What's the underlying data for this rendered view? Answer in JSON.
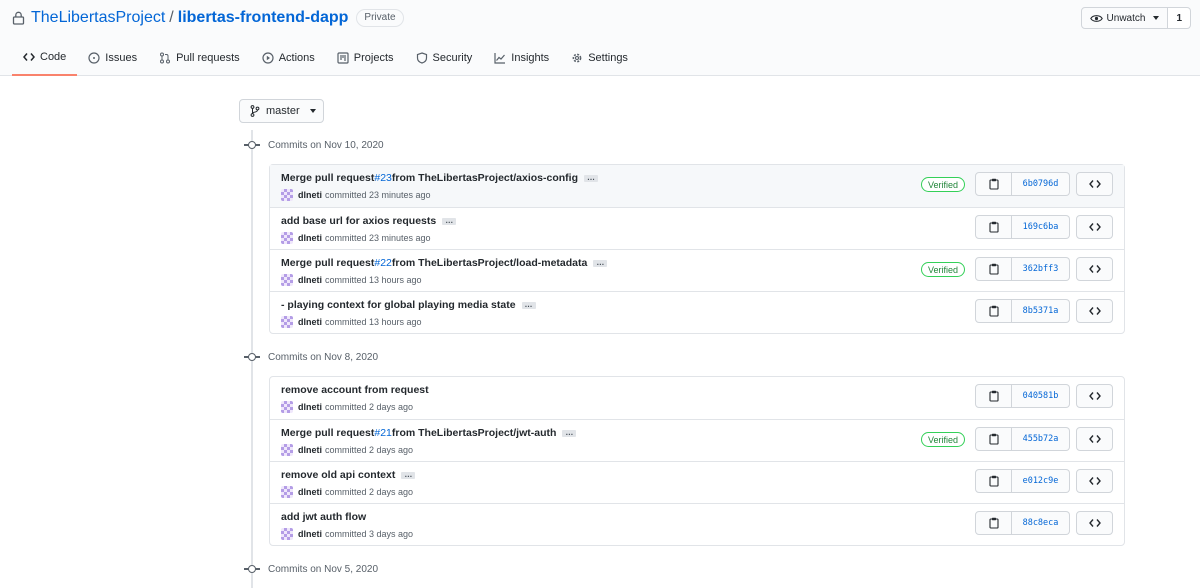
{
  "repo": {
    "owner": "TheLibertasProject",
    "separator": "/",
    "name": "libertas-frontend-dapp",
    "visibility": "Private"
  },
  "watch": {
    "label": "Unwatch",
    "count": "1"
  },
  "tabs": [
    {
      "label": "Code",
      "icon": "code-icon",
      "selected": true
    },
    {
      "label": "Issues",
      "icon": "issue-icon"
    },
    {
      "label": "Pull requests",
      "icon": "pull-request-icon"
    },
    {
      "label": "Actions",
      "icon": "play-icon"
    },
    {
      "label": "Projects",
      "icon": "project-icon"
    },
    {
      "label": "Security",
      "icon": "shield-icon"
    },
    {
      "label": "Insights",
      "icon": "graph-icon"
    },
    {
      "label": "Settings",
      "icon": "gear-icon"
    }
  ],
  "branch": {
    "name": "master"
  },
  "colors": {
    "link": "#0366d6",
    "tab_underline": "#f9826c",
    "verified": "#22863a"
  },
  "groups": [
    {
      "label": "Commits on Nov 10, 2020",
      "commits": [
        {
          "prefix": "Merge pull request ",
          "pr": "#23",
          "suffix": " from TheLibertasProject/axios-config",
          "author": "dlneti",
          "time": "committed 23 minutes ago",
          "verified": "Verified",
          "sha": "6b0796d",
          "highlight": true
        },
        {
          "prefix": "add base url for axios requests",
          "pr": "",
          "suffix": "",
          "author": "dlneti",
          "time": "committed 23 minutes ago",
          "verified": "",
          "sha": "169c6ba"
        },
        {
          "prefix": "Merge pull request ",
          "pr": "#22",
          "suffix": " from TheLibertasProject/load-metadata",
          "author": "dlneti",
          "time": "committed 13 hours ago",
          "verified": "Verified",
          "sha": "362bff3"
        },
        {
          "prefix": "- playing context for global playing media state",
          "pr": "",
          "suffix": "",
          "author": "dlneti",
          "time": "committed 13 hours ago",
          "verified": "",
          "sha": "8b5371a"
        }
      ]
    },
    {
      "label": "Commits on Nov 8, 2020",
      "commits": [
        {
          "prefix": "remove account from request",
          "pr": "",
          "suffix": "",
          "author": "dlneti",
          "time": "committed 2 days ago",
          "verified": "",
          "sha": "040581b",
          "noEllipsis": true
        },
        {
          "prefix": "Merge pull request ",
          "pr": "#21",
          "suffix": " from TheLibertasProject/jwt-auth",
          "author": "dlneti",
          "time": "committed 2 days ago",
          "verified": "Verified",
          "sha": "455b72a"
        },
        {
          "prefix": "remove old api context",
          "pr": "",
          "suffix": "",
          "author": "dlneti",
          "time": "committed 2 days ago",
          "verified": "",
          "sha": "e012c9e"
        },
        {
          "prefix": "add jwt auth flow",
          "pr": "",
          "suffix": "",
          "author": "dlneti",
          "time": "committed 3 days ago",
          "verified": "",
          "sha": "88c8eca",
          "noEllipsis": true
        }
      ]
    },
    {
      "label": "Commits on Nov 5, 2020",
      "commits": []
    }
  ]
}
